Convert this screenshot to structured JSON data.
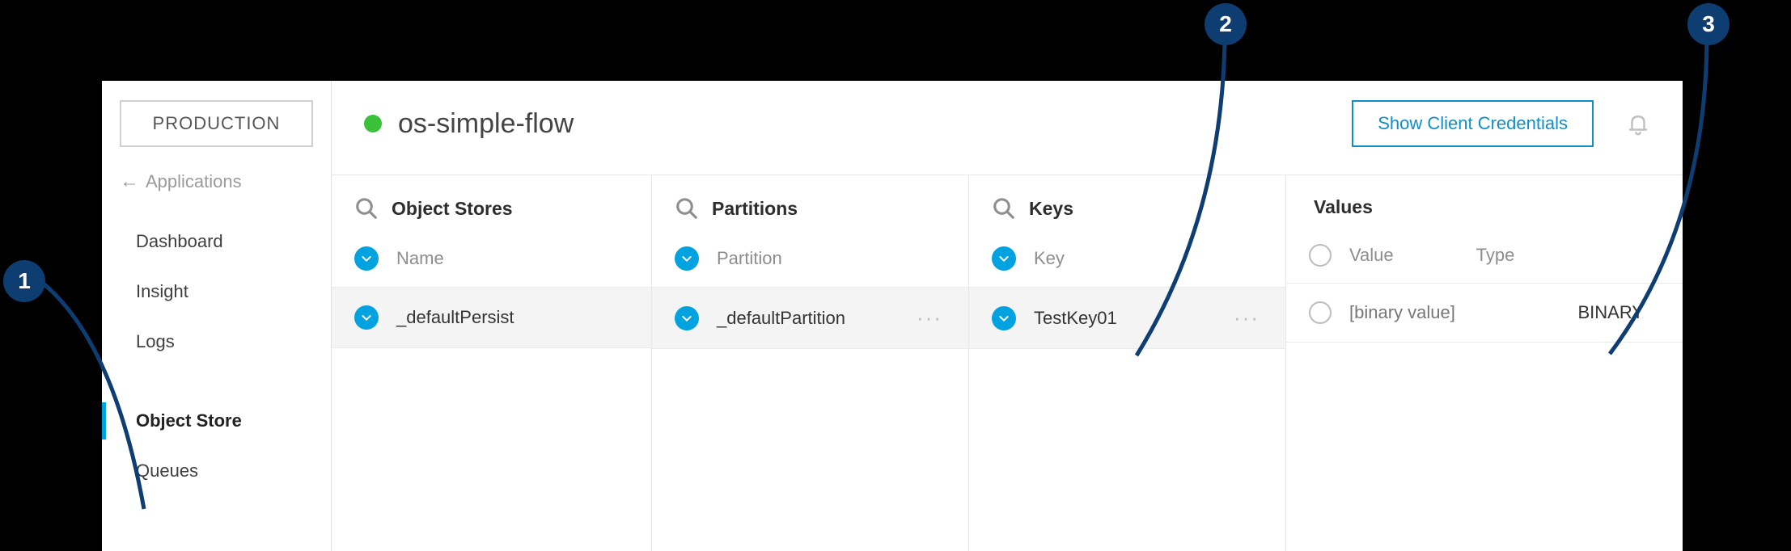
{
  "sidebar": {
    "env_label": "PRODUCTION",
    "back_label": "Applications",
    "items": [
      {
        "label": "Dashboard",
        "active": false
      },
      {
        "label": "Insight",
        "active": false
      },
      {
        "label": "Logs",
        "active": false
      },
      {
        "label": "",
        "spacer": true
      },
      {
        "label": "Object Store",
        "active": true
      },
      {
        "label": "Queues",
        "active": false
      }
    ]
  },
  "header": {
    "app_name": "os-simple-flow",
    "status_color": "#3ac13a",
    "credentials_button": "Show Client Credentials"
  },
  "columns": {
    "object_stores": {
      "title": "Object Stores",
      "sub_label": "Name",
      "row_value": "_defaultPersist"
    },
    "partitions": {
      "title": "Partitions",
      "sub_label": "Partition",
      "row_value": "_defaultPartition"
    },
    "keys": {
      "title": "Keys",
      "sub_label": "Key",
      "row_value": "TestKey01"
    },
    "values": {
      "title": "Values",
      "sub_label_value": "Value",
      "sub_label_type": "Type",
      "row_value": "[binary value]",
      "row_type": "BINARY"
    }
  },
  "annotations": {
    "a1": "1",
    "a2": "2",
    "a3": "3"
  },
  "colors": {
    "accent": "#00a2df",
    "callout": "#0e3d72",
    "link": "#0f8ec7"
  }
}
